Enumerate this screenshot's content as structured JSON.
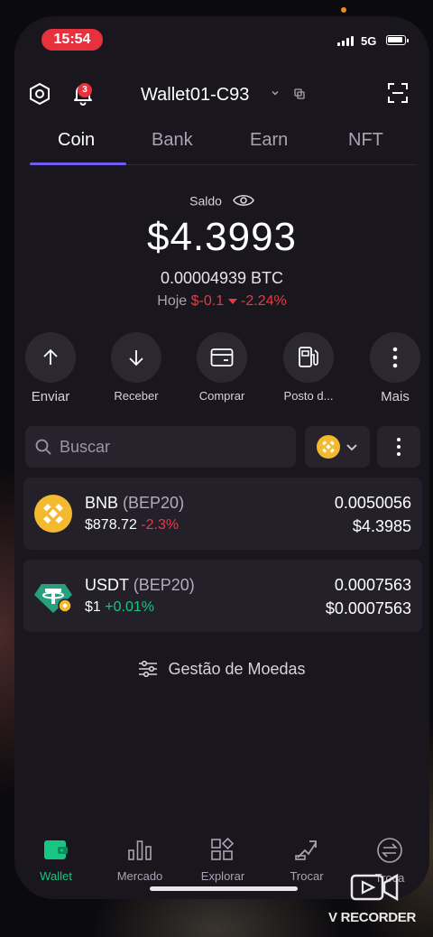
{
  "status_bar": {
    "time": "15:54",
    "network": "5G"
  },
  "header": {
    "notification_count": "3",
    "wallet_name": "Wallet01-C93"
  },
  "tabs": [
    {
      "label": "Coin",
      "active": true
    },
    {
      "label": "Bank"
    },
    {
      "label": "Earn"
    },
    {
      "label": "NFT"
    }
  ],
  "balance": {
    "label": "Saldo",
    "amount": "$4.3993",
    "btc": "0.00004939 BTC",
    "today_label": "Hoje",
    "today_change": "$-0.1",
    "today_pct": "-2.24%"
  },
  "actions": [
    {
      "label": "Enviar",
      "icon": "arrow-up-icon"
    },
    {
      "label": "Receber",
      "icon": "arrow-down-icon"
    },
    {
      "label": "Comprar",
      "icon": "card-icon"
    },
    {
      "label": "Posto d...",
      "icon": "fuel-station-icon"
    },
    {
      "label": "Mais",
      "icon": "more-vertical-icon"
    }
  ],
  "search": {
    "placeholder": "Buscar"
  },
  "assets": [
    {
      "symbol": "BNB",
      "network": "(BEP20)",
      "price": "$878.72",
      "change": "-2.3%",
      "quantity": "0.0050056",
      "value": "$4.3985"
    },
    {
      "symbol": "USDT",
      "network": "(BEP20)",
      "price": "$1",
      "change": "+0.01%",
      "quantity": "0.0007563",
      "value": "$0.0007563"
    }
  ],
  "manage_label": "Gestão de Moedas",
  "bottom_nav": [
    {
      "label": "Wallet",
      "active": true
    },
    {
      "label": "Mercado"
    },
    {
      "label": "Explorar"
    },
    {
      "label": "Trocar"
    },
    {
      "label": "Troca"
    }
  ],
  "watermark": "V RECORDER",
  "colors": {
    "accent": "#6d5df0",
    "negative": "#ea3943",
    "positive": "#16c784",
    "bnb": "#f3ba2f",
    "usdt": "#26a17b"
  }
}
